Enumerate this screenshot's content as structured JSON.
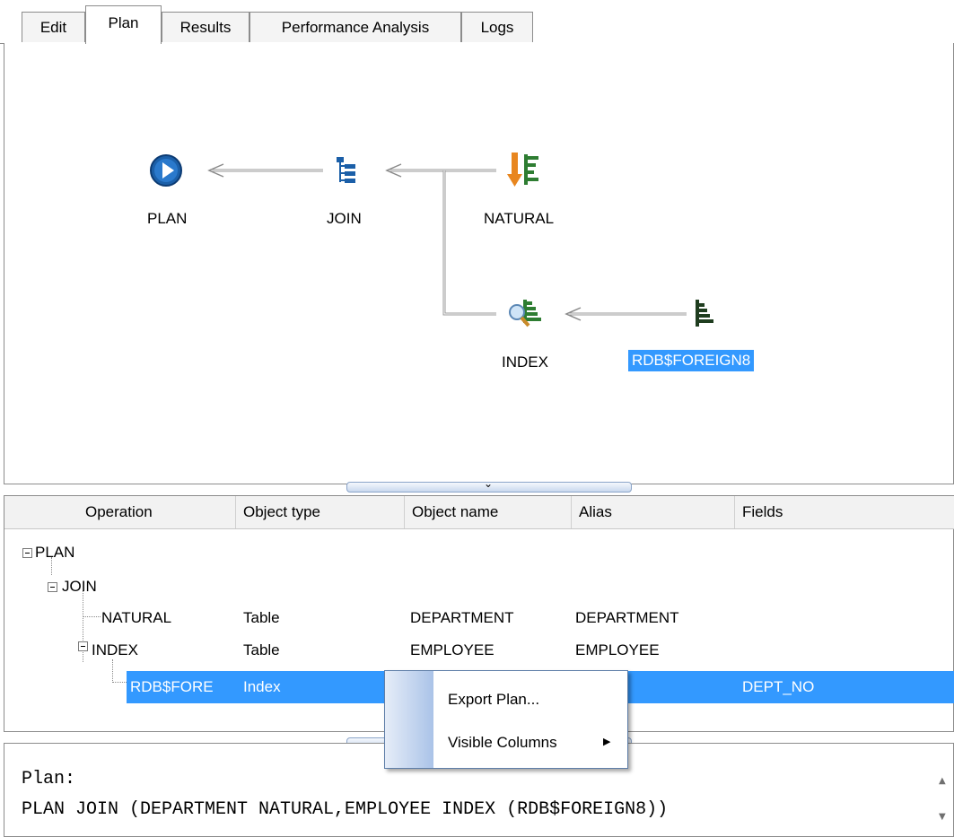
{
  "tabs": [
    {
      "label": "Edit",
      "active": false
    },
    {
      "label": "Plan",
      "active": true
    },
    {
      "label": "Results",
      "active": false
    },
    {
      "label": "Performance Analysis",
      "active": false
    },
    {
      "label": "Logs",
      "active": false
    }
  ],
  "diagram": {
    "nodes": [
      {
        "label": "PLAN",
        "icon": "play-circle-icon"
      },
      {
        "label": "JOIN",
        "icon": "tree-join-icon"
      },
      {
        "label": "NATURAL",
        "icon": "sort-natural-icon"
      },
      {
        "label": "INDEX",
        "icon": "index-search-icon"
      },
      {
        "label": "RDB$FOREIGN8",
        "icon": "index-bars-icon",
        "selected": true
      }
    ]
  },
  "grid": {
    "columns": [
      "Operation",
      "Object type",
      "Object name",
      "Alias",
      "Fields"
    ],
    "rows": [
      {
        "operation": "PLAN",
        "object_type": "",
        "object_name": "",
        "alias": "",
        "fields": ""
      },
      {
        "operation": "JOIN",
        "object_type": "",
        "object_name": "",
        "alias": "",
        "fields": ""
      },
      {
        "operation": "NATURAL",
        "object_type": "Table",
        "object_name": "DEPARTMENT",
        "alias": "DEPARTMENT",
        "fields": ""
      },
      {
        "operation": "INDEX",
        "object_type": "Table",
        "object_name": "EMPLOYEE",
        "alias": "EMPLOYEE",
        "fields": ""
      },
      {
        "operation": "RDB$FORE",
        "object_type": "Index",
        "object_name": "",
        "alias": "",
        "fields": "DEPT_NO",
        "selected": true
      }
    ]
  },
  "context_menu": {
    "items": [
      {
        "label": "Export Plan..."
      },
      {
        "label": "Visible Columns",
        "submenu_glyph": "▶"
      }
    ]
  },
  "plan_text": {
    "line1": "Plan:",
    "line2": "PLAN JOIN (DEPARTMENT NATURAL,EMPLOYEE INDEX (RDB$FOREIGN8))"
  },
  "colors": {
    "selection": "#3399ff",
    "icon_blue": "#1b5fa8",
    "icon_green": "#2e7d32",
    "icon_orange": "#e8861f"
  }
}
